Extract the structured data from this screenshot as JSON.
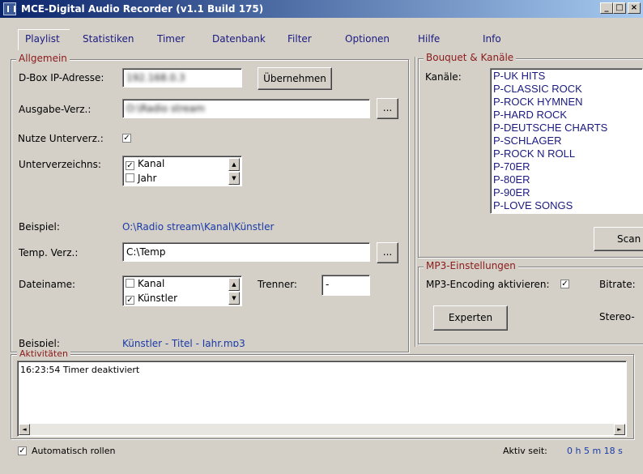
{
  "window": {
    "title": "MCE-Digital Audio Recorder (v1.1 Build 175)",
    "controls": {
      "minimize": "_",
      "maximize": "□",
      "close": "×"
    }
  },
  "tabs": [
    "Playlist",
    "Statistiken",
    "Timer",
    "Datenbank",
    "Filter",
    "Optionen",
    "Hilfe",
    "Info"
  ],
  "allgemein": {
    "group_label": "Allgemein",
    "dbox_label": "D-Box IP-Adresse:",
    "dbox_value": "192.168.0.3",
    "apply_button": "Übernehmen",
    "output_label": "Ausgabe-Verz.:",
    "output_value": "O:\\Radio stream",
    "browse_button": "...",
    "use_subdirs_label": "Nutze Unterverz.:",
    "use_subdirs_check": "✓",
    "subdirs_label": "Unterverzeichns:",
    "subdirs_items": [
      {
        "label": "Kanal",
        "check": "✓"
      },
      {
        "label": "Jahr",
        "check": ""
      }
    ],
    "example_label": "Beispiel:",
    "example_path": "O:\\Radio stream\\Kanal\\Künstler",
    "temp_label": "Temp. Verz.:",
    "temp_value": "C:\\Temp",
    "temp_browse": "...",
    "filename_label": "Dateiname:",
    "filename_items": [
      {
        "label": "Kanal",
        "check": ""
      },
      {
        "label": "Künstler",
        "check": "✓"
      }
    ],
    "separator_label": "Trenner:",
    "separator_value": "-",
    "example2_label": "Beispiel:",
    "example2_value": "Künstler - Titel - Jahr.mp3"
  },
  "bouquet": {
    "group_label": "Bouquet & Kanäle",
    "channels_label": "Kanäle:",
    "channels": [
      "P-UK HITS",
      "P-CLASSIC ROCK",
      "P-ROCK HYMNEN",
      "P-HARD ROCK",
      "P-DEUTSCHE CHARTS",
      "P-SCHLAGER",
      "P-ROCK N ROLL",
      "P-70ER",
      "P-80ER",
      "P-90ER",
      "P-LOVE SONGS"
    ],
    "scan_button": "Scan"
  },
  "mp3": {
    "group_label": "MP3-Einstellungen",
    "encoding_label": "MP3-Encoding aktivieren:",
    "encoding_check": "✓",
    "bitrate_label": "Bitrate:",
    "stereo_label": "Stereo-",
    "expert_button": "Experten"
  },
  "activities": {
    "group_label": "Aktivitäten",
    "log": [
      "16:23:54 Timer deaktiviert"
    ],
    "scroll_left": "◄",
    "scroll_right": "►"
  },
  "status": {
    "auto_scroll_check": "✓",
    "auto_scroll_label": "Automatisch rollen",
    "active_since_label": "Aktiv seit:",
    "active_since_value": "0 h 5 m 18 s"
  }
}
